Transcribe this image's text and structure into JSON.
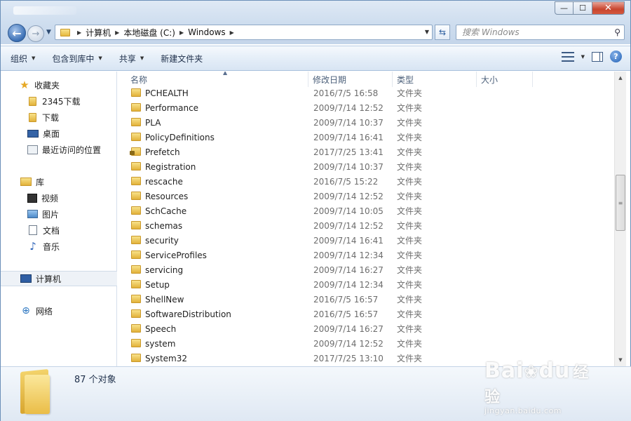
{
  "window": {
    "controls": {
      "minimize": "—",
      "maximize": "☐",
      "close": "✕"
    }
  },
  "address": {
    "crumbs": [
      "计算机",
      "本地磁盘 (C:)",
      "Windows"
    ]
  },
  "search": {
    "placeholder": "搜索 Windows"
  },
  "toolbar": {
    "organize": "组织",
    "include_in_library": "包含到库中",
    "share": "共享",
    "new_folder": "新建文件夹"
  },
  "nav": {
    "favorites": "收藏夹",
    "fav_items": [
      "2345下载",
      "下载",
      "桌面",
      "最近访问的位置"
    ],
    "library": "库",
    "lib_items": [
      "视频",
      "图片",
      "文档",
      "音乐"
    ],
    "computer": "计算机",
    "network": "网络"
  },
  "columns": {
    "name": "名称",
    "date": "修改日期",
    "type": "类型",
    "size": "大小"
  },
  "files": [
    {
      "name": "PCHEALTH",
      "date": "2016/7/5 16:58",
      "type": "文件夹"
    },
    {
      "name": "Performance",
      "date": "2009/7/14 12:52",
      "type": "文件夹"
    },
    {
      "name": "PLA",
      "date": "2009/7/14 10:37",
      "type": "文件夹"
    },
    {
      "name": "PolicyDefinitions",
      "date": "2009/7/14 16:41",
      "type": "文件夹"
    },
    {
      "name": "Prefetch",
      "date": "2017/7/25 13:41",
      "type": "文件夹"
    },
    {
      "name": "Registration",
      "date": "2009/7/14 10:37",
      "type": "文件夹"
    },
    {
      "name": "rescache",
      "date": "2016/7/5 15:22",
      "type": "文件夹"
    },
    {
      "name": "Resources",
      "date": "2009/7/14 12:52",
      "type": "文件夹"
    },
    {
      "name": "SchCache",
      "date": "2009/7/14 10:05",
      "type": "文件夹"
    },
    {
      "name": "schemas",
      "date": "2009/7/14 12:52",
      "type": "文件夹"
    },
    {
      "name": "security",
      "date": "2009/7/14 16:41",
      "type": "文件夹"
    },
    {
      "name": "ServiceProfiles",
      "date": "2009/7/14 12:34",
      "type": "文件夹"
    },
    {
      "name": "servicing",
      "date": "2009/7/14 16:27",
      "type": "文件夹"
    },
    {
      "name": "Setup",
      "date": "2009/7/14 12:34",
      "type": "文件夹"
    },
    {
      "name": "ShellNew",
      "date": "2016/7/5 16:57",
      "type": "文件夹"
    },
    {
      "name": "SoftwareDistribution",
      "date": "2016/7/5 16:57",
      "type": "文件夹"
    },
    {
      "name": "Speech",
      "date": "2009/7/14 16:27",
      "type": "文件夹"
    },
    {
      "name": "system",
      "date": "2009/7/14 12:52",
      "type": "文件夹"
    },
    {
      "name": "System32",
      "date": "2017/7/25 13:10",
      "type": "文件夹"
    }
  ],
  "details": {
    "count": "87 个对象"
  },
  "watermark": {
    "logo": "Bai",
    "logo2": "du",
    "suffix": "经验",
    "url": "jingyan.baidu.com"
  },
  "colors": {
    "titlebar": "#cfdeef",
    "accent": "#3a6fb5",
    "close": "#c8452e",
    "folder": "#e2b23a"
  }
}
